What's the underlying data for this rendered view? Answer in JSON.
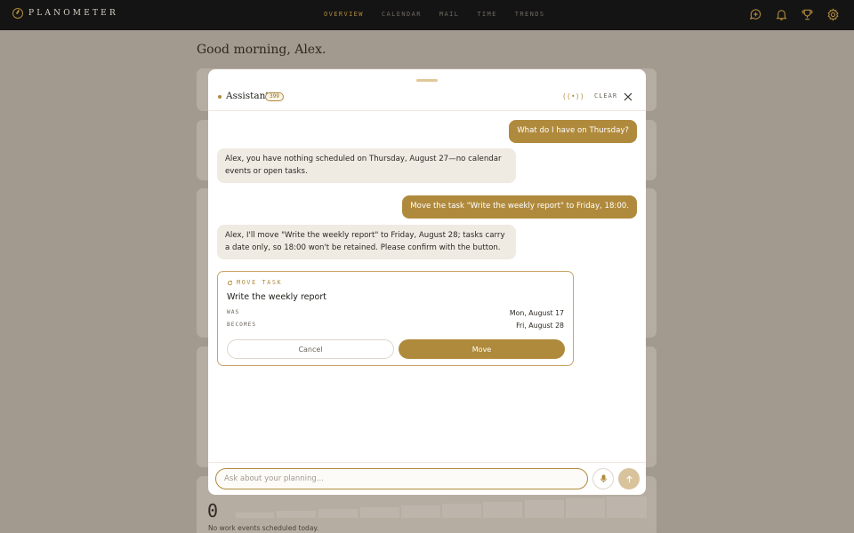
{
  "app": {
    "name": "PLANOMETER"
  },
  "nav": {
    "items": [
      {
        "label": "OVERVIEW",
        "active": true
      },
      {
        "label": "CALENDAR",
        "active": false
      },
      {
        "label": "MAIL",
        "active": false
      },
      {
        "label": "TIME",
        "active": false
      },
      {
        "label": "TRENDS",
        "active": false
      }
    ],
    "icons": [
      "assistant-icon",
      "bell-icon",
      "trophy-icon",
      "gear-icon"
    ]
  },
  "page": {
    "greeting": "Good morning, Alex.",
    "work_events_count": "0",
    "work_events_note": "No work events scheduled today."
  },
  "assistant": {
    "title": "Assistant",
    "badge": "399",
    "voice_label": "((•))",
    "clear_label": "CLEAR",
    "messages": [
      {
        "role": "user",
        "text": "What do I have on Thursday?"
      },
      {
        "role": "assistant",
        "text": "Alex, you have nothing scheduled on Thursday, August 27—no calendar events or open tasks."
      },
      {
        "role": "user",
        "text": "Move the task \"Write the weekly report\" to Friday, 18:00."
      },
      {
        "role": "assistant",
        "text": "Alex, I'll move \"Write the weekly report\" to Friday, August 28; tasks carry a date only, so 18:00 won't be retained. Please confirm with the button."
      }
    ],
    "move_card": {
      "label": "MOVE TASK",
      "task_title": "Write the weekly report",
      "was_label": "WAS",
      "was_value": "Mon, August 17",
      "becomes_label": "BECOMES",
      "becomes_value": "Fri, August 28",
      "cancel_label": "Cancel",
      "move_label": "Move"
    },
    "input_placeholder": "Ask about your planning..."
  },
  "colors": {
    "accent": "#b08a3c",
    "topbar": "#141414",
    "backdrop": "#a39a8f",
    "assistant_bubble": "#efeae2"
  }
}
